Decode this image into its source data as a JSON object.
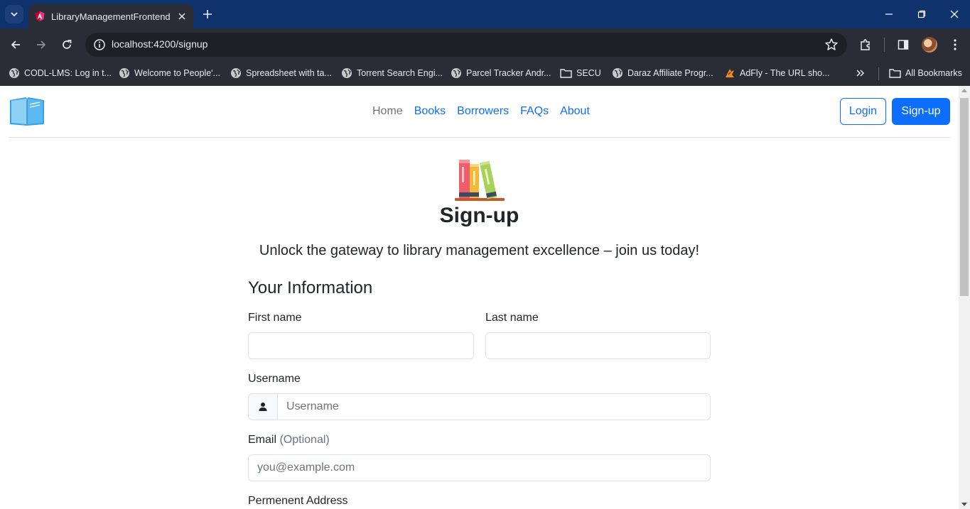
{
  "browser": {
    "tab_title": "LibraryManagementFrontend",
    "url": "localhost:4200/signup",
    "bookmarks": [
      {
        "label": "CODL-LMS: Log in t...",
        "icon": "globe-icon"
      },
      {
        "label": "Welcome to People'...",
        "icon": "globe-icon"
      },
      {
        "label": "Spreadsheet with ta...",
        "icon": "globe-icon"
      },
      {
        "label": "Torrent Search Engi...",
        "icon": "globe-icon"
      },
      {
        "label": "Parcel Tracker Andr...",
        "icon": "globe-icon"
      },
      {
        "label": "SECU",
        "icon": "folder-icon"
      },
      {
        "label": "Daraz Affiliate Progr...",
        "icon": "globe-icon"
      },
      {
        "label": "AdFly - The URL sho...",
        "icon": "adfly-icon"
      }
    ],
    "all_bookmarks_label": "All Bookmarks"
  },
  "header": {
    "nav": [
      {
        "label": "Home",
        "active": true
      },
      {
        "label": "Books",
        "active": false
      },
      {
        "label": "Borrowers",
        "active": false
      },
      {
        "label": "FAQs",
        "active": false
      },
      {
        "label": "About",
        "active": false
      }
    ],
    "login_label": "Login",
    "signup_label": "Sign-up"
  },
  "main": {
    "title": "Sign-up",
    "lead": "Unlock the gateway to library management excellence – join us today!",
    "section_title": "Your Information",
    "first_name_label": "First name",
    "last_name_label": "Last name",
    "username_label": "Username",
    "username_placeholder": "Username",
    "email_label": "Email",
    "email_optional": "(Optional)",
    "email_placeholder": "you@example.com",
    "address_label": "Permenent Address"
  },
  "colors": {
    "primary": "#0d6efd",
    "tab_bar": "#0f326d",
    "toolbar": "#2b2d36"
  }
}
